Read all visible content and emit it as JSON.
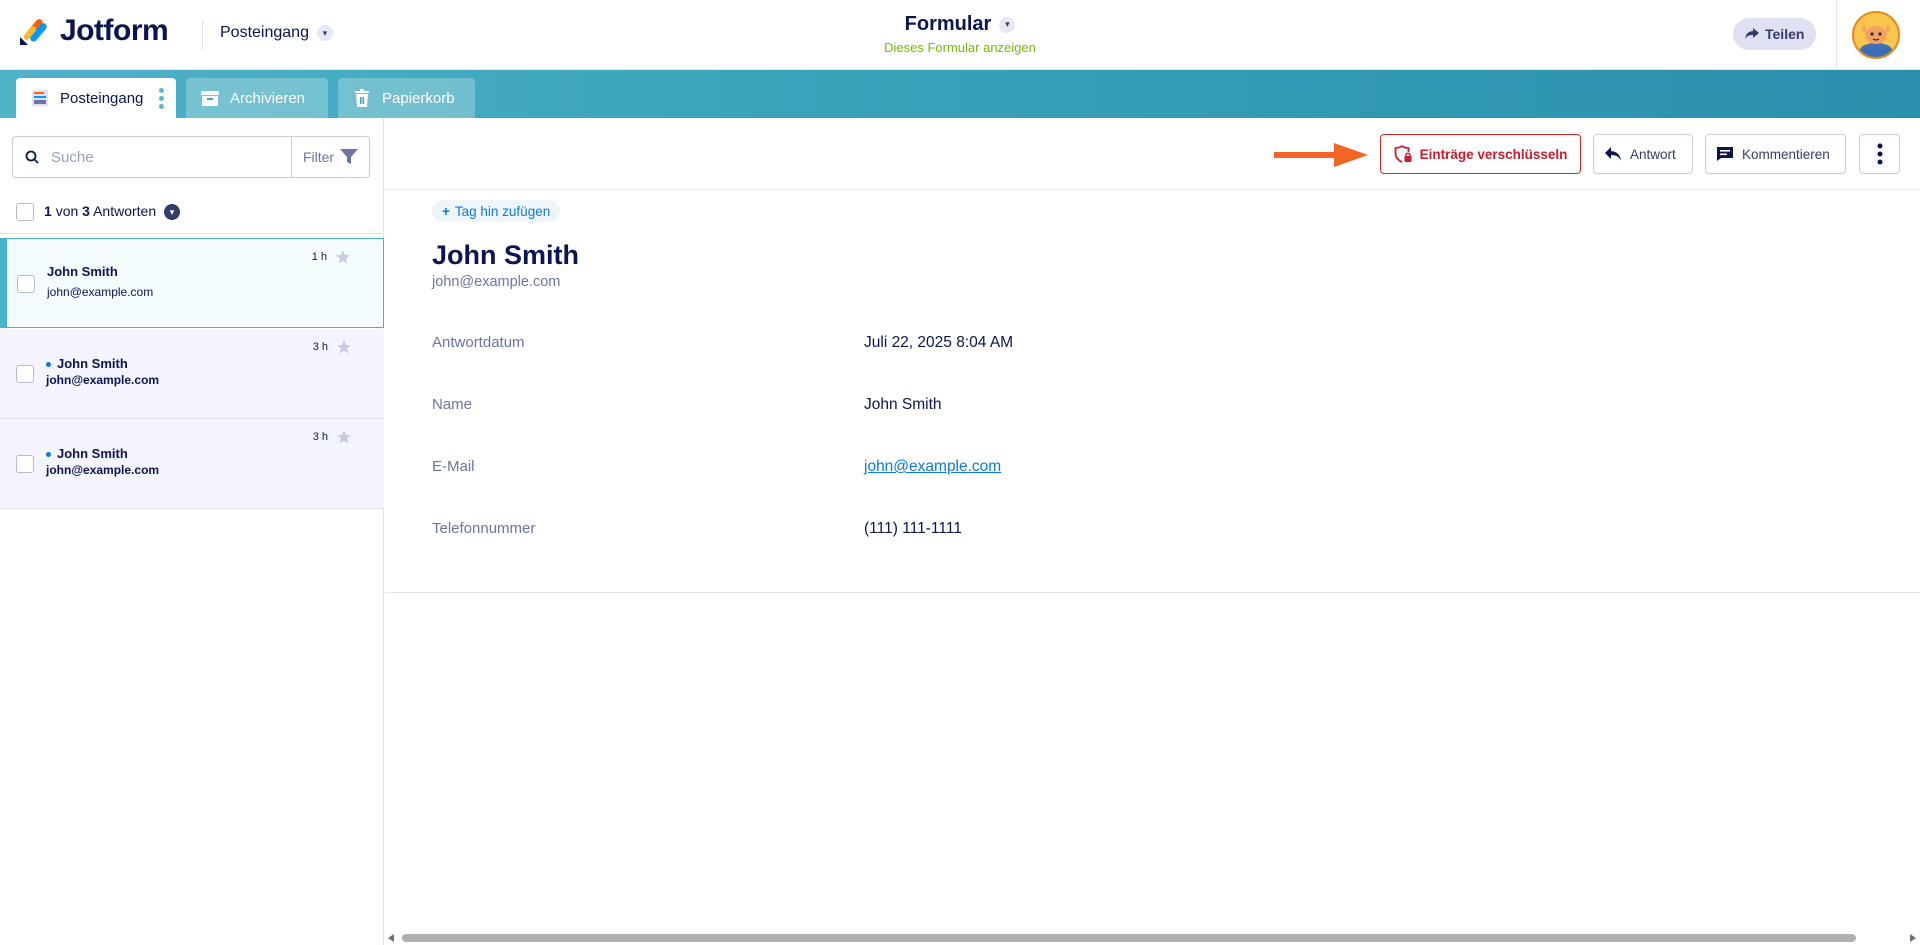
{
  "header": {
    "logo_text": "Jotform",
    "inbox_selector": "Posteingang",
    "form_title": "Formular",
    "form_subtitle": "Dieses Formular anzeigen",
    "share_label": "Teilen"
  },
  "tabs": [
    {
      "label": "Posteingang",
      "icon": "inbox-icon",
      "active": true
    },
    {
      "label": "Archivieren",
      "icon": "archive-icon",
      "active": false
    },
    {
      "label": "Papierkorb",
      "icon": "trash-icon",
      "active": false
    }
  ],
  "list": {
    "search_placeholder": "Suche",
    "filter_label": "Filter",
    "count": {
      "current": "1",
      "word_of": "von",
      "total": "3",
      "word_answers": "Antworten"
    },
    "entries": [
      {
        "name": "John Smith",
        "email": "john@example.com",
        "time": "1 h",
        "selected": true,
        "unread": false
      },
      {
        "name": "John Smith",
        "email": "john@example.com",
        "time": "3 h",
        "selected": false,
        "unread": true
      },
      {
        "name": "John Smith",
        "email": "john@example.com",
        "time": "3 h",
        "selected": false,
        "unread": true
      }
    ]
  },
  "toolbar": {
    "encrypt_label": "Einträge verschlüsseln",
    "reply_label": "Antwort",
    "comments_label": "Kommentieren"
  },
  "detail": {
    "add_tag_label": "Tag hin zufügen",
    "name": "John Smith",
    "email": "john@example.com",
    "fields": [
      {
        "label": "Antwortdatum",
        "value": "Juli 22, 2025 8:04 AM"
      },
      {
        "label": "Name",
        "value": "John Smith"
      },
      {
        "label": "E-Mail",
        "value": "john@example.com",
        "is_link": true
      },
      {
        "label": "Telefonnummer",
        "value": "(111) 111-1111"
      }
    ]
  },
  "colors": {
    "accent_teal": "#47b4cb",
    "encrypt_red": "#dc2626",
    "link_blue": "#0a7be0",
    "subtitle_green": "#78bb07",
    "arrow_orange": "#f26522"
  }
}
